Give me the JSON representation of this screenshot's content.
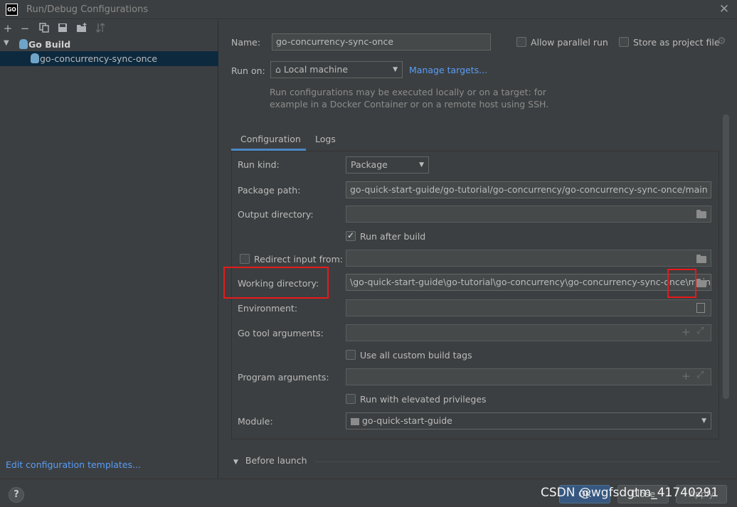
{
  "window": {
    "app_icon_text": "GO",
    "title": "Run/Debug Configurations",
    "close_symbol": "✕"
  },
  "left": {
    "toolbar_icons": [
      "add-icon",
      "remove-icon",
      "copy-icon",
      "save-icon",
      "add-folder-icon",
      "sort-icon"
    ],
    "tree": {
      "root_label": "Go Build",
      "child_label": "go-concurrency-sync-once"
    },
    "templates_link": "Edit configuration templates..."
  },
  "form": {
    "name_label": "Name:",
    "name_value": "go-concurrency-sync-once",
    "allow_parallel_label": "Allow parallel run",
    "store_project_label": "Store as project file",
    "run_on_label": "Run on:",
    "run_on_value": "Local machine",
    "manage_targets": "Manage targets...",
    "help_line1": "Run configurations may be executed locally or on a target: for",
    "help_line2": "example in a Docker Container or on a remote host using SSH.",
    "tabs": [
      "Configuration",
      "Logs"
    ],
    "run_kind_label": "Run kind:",
    "run_kind_value": "Package",
    "package_path_label": "Package path:",
    "package_path_value": "go-quick-start-guide/go-tutorial/go-concurrency/go-concurrency-sync-once/main",
    "output_dir_label": "Output directory:",
    "output_dir_value": "",
    "run_after_build_label": "Run after build",
    "run_after_build_checked": true,
    "redirect_input_label": "Redirect input from:",
    "redirect_input_value": "",
    "working_dir_label": "Working directory:",
    "working_dir_value": "\\go-quick-start-guide\\go-tutorial\\go-concurrency\\go-concurrency-sync-once\\main",
    "environment_label": "Environment:",
    "go_tool_args_label": "Go tool arguments:",
    "custom_build_tags_label": "Use all custom build tags",
    "program_args_label": "Program arguments:",
    "elevated_label": "Run with elevated privileges",
    "module_label": "Module:",
    "module_value": "go-quick-start-guide",
    "before_launch_label": "Before launch"
  },
  "footer": {
    "help_symbol": "?",
    "ok_label": "OK",
    "close_label": "Close",
    "apply_label": "Apply",
    "watermark": "CSDN @wgfsdgtm_41740291"
  },
  "colors": {
    "background": "#3c3f41",
    "selection": "#0d293e",
    "link": "#589df6",
    "highlight_red": "#e8191a",
    "tab_accent": "#4a88c7"
  }
}
